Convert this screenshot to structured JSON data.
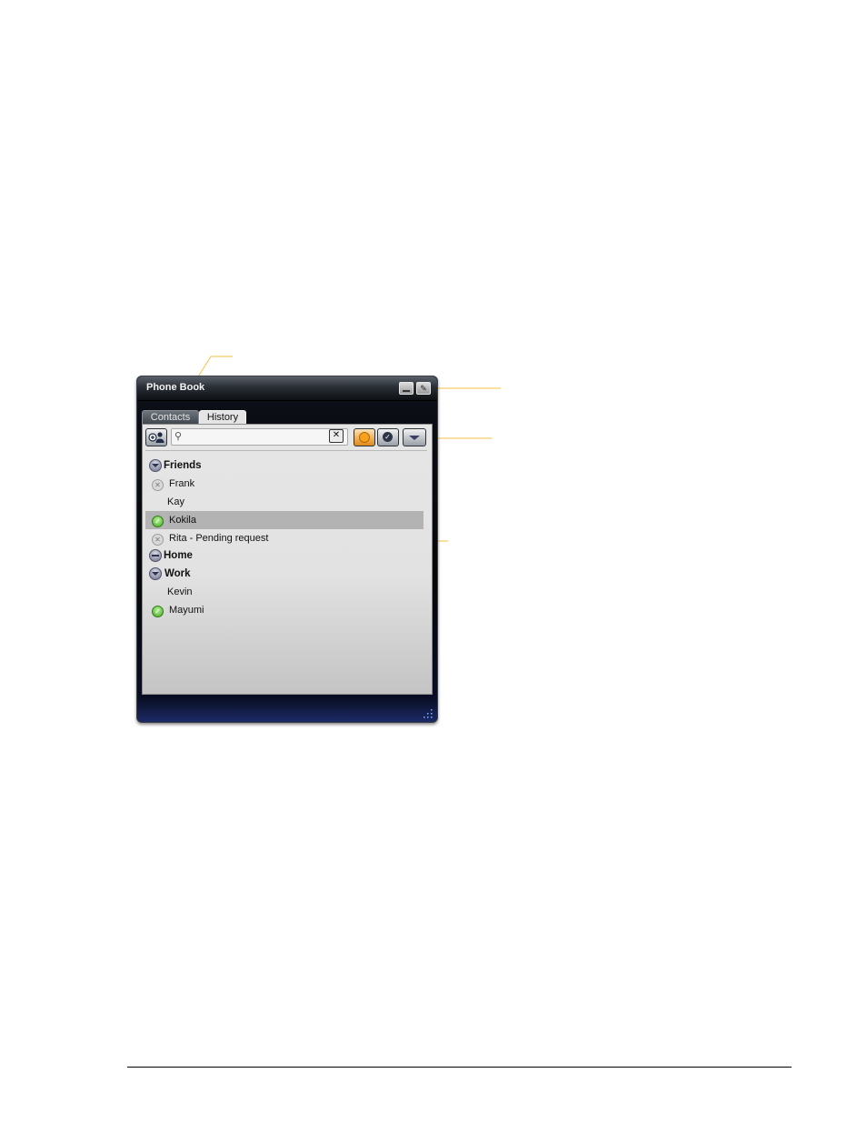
{
  "window": {
    "title": "Phone Book",
    "minimize_label": "",
    "edit_label": "✎"
  },
  "tabs": [
    {
      "label": "Contacts",
      "active": false
    },
    {
      "label": "History",
      "active": true
    }
  ],
  "toolbar": {
    "search_placeholder": "",
    "search_value": "",
    "clear_label": "✕",
    "status_label": "✓"
  },
  "list": {
    "groups": [
      {
        "label": "Friends",
        "expanded": true
      },
      {
        "label": "Home",
        "expanded": false
      },
      {
        "label": "Work",
        "expanded": true
      }
    ],
    "contacts": [
      {
        "name": "Frank",
        "status": "offline",
        "group": "Friends"
      },
      {
        "name": "Kay",
        "status": "none",
        "group": "Friends"
      },
      {
        "name": "Kokila",
        "status": "online",
        "group": "Friends",
        "selected": true
      },
      {
        "name": "Rita - Pending request",
        "status": "offline",
        "group": "Friends"
      },
      {
        "name": "Kevin",
        "status": "none",
        "group": "Work"
      },
      {
        "name": "Mayumi",
        "status": "online",
        "group": "Work"
      }
    ]
  },
  "colors": {
    "callout": "#f5c242",
    "selection": "#b3b3b3",
    "online": "#43a81f",
    "away": "#f6a21c"
  },
  "icons": {
    "add_contact": "add-contact-icon",
    "search": "search-icon",
    "clear": "clear-icon",
    "away": "away-status-icon",
    "status": "status-check-icon",
    "more": "chevron-down-icon",
    "resize": "resize-grip-icon"
  }
}
